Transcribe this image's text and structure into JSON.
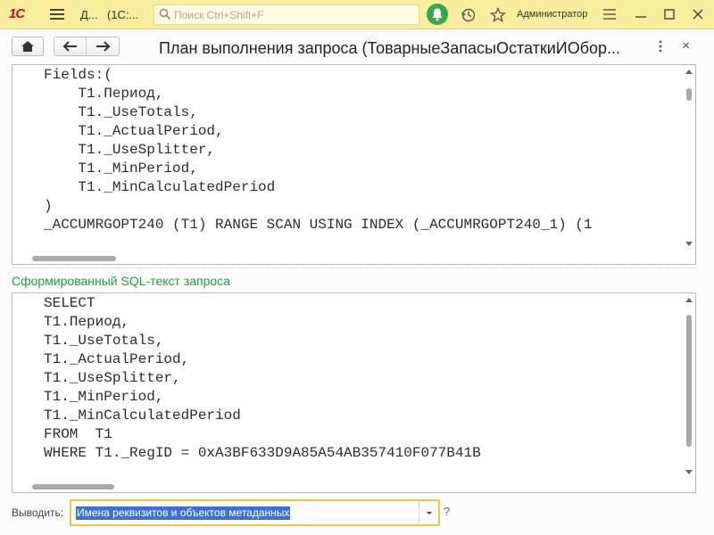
{
  "titlebar": {
    "logo": "1С",
    "app_short": "Д...",
    "app_name": "(1С:...",
    "search_placeholder": "Поиск Ctrl+Shift+F",
    "user": "Администратор"
  },
  "form": {
    "title": "План выполнения запроса (ТоварныеЗапасыОстаткиИОбор...",
    "close": "×"
  },
  "plan_pane": {
    "lines": [
      "Fields:(",
      "    T1.Период,",
      "    T1._UseTotals,",
      "    T1._ActualPeriod,",
      "    T1._UseSplitter,",
      "    T1._MinPeriod,",
      "    T1._MinCalculatedPeriod",
      ")",
      "_ACCUMRGOPT240 (T1) RANGE SCAN USING INDEX (_ACCUMRGOPT240_1) (1"
    ]
  },
  "sql_section": {
    "label": "Сформированный SQL-текст запроса",
    "lines": [
      "SELECT",
      "T1.Период,",
      "T1._UseTotals,",
      "T1._ActualPeriod,",
      "T1._UseSplitter,",
      "T1._MinPeriod,",
      "T1._MinCalculatedPeriod",
      "FROM  T1",
      "WHERE T1._RegID = 0xA3BF633D9A85A54AB357410F077B41B"
    ]
  },
  "footer": {
    "output_label": "Выводить:",
    "output_value": "Имена реквизитов и объектов метаданных",
    "help": "?"
  },
  "colors": {
    "titlebar_bg": "#fbed9e",
    "accent_green": "#20a33a",
    "selection": "#3b72d8",
    "focus_border": "#f5c542"
  }
}
